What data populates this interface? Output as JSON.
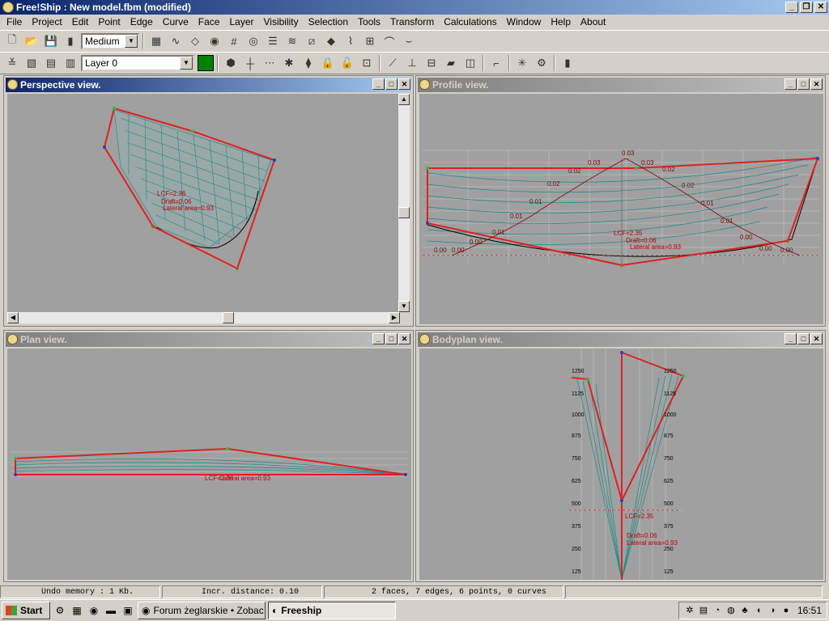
{
  "window": {
    "title": "Free!Ship  : New model.fbm (modified)"
  },
  "menu": [
    "File",
    "Project",
    "Edit",
    "Point",
    "Edge",
    "Curve",
    "Face",
    "Layer",
    "Visibility",
    "Selection",
    "Tools",
    "Transform",
    "Calculations",
    "Window",
    "Help",
    "About"
  ],
  "toolbar": {
    "precision": "Medium",
    "layer": "Layer 0",
    "layer_color": "#008000"
  },
  "views": {
    "perspective": {
      "title": "Perspective view."
    },
    "profile": {
      "title": "Profile view."
    },
    "plan": {
      "title": "Plan view."
    },
    "bodyplan": {
      "title": "Bodyplan view."
    }
  },
  "annotations": {
    "lcf": "LCF=2.36",
    "lcf_b": "LCF=2.35",
    "lateral": "Lateral area=0.93",
    "draft": "Draft=0.06",
    "lcf_plan": "LCF=2.36"
  },
  "profile_curve_labels": [
    "0.00",
    "0.00",
    "0.00",
    "0.01",
    "0.01",
    "0.01",
    "0.02",
    "0.02",
    "0.03",
    "0.03",
    "0.03",
    "0.02",
    "0.02",
    "0.01",
    "0.01",
    "0.00",
    "0.00",
    "0.00"
  ],
  "bodyplan_scale_left": [
    "1250",
    "1125",
    "1000",
    "875",
    "750",
    "625",
    "500",
    "375",
    "250",
    "125"
  ],
  "bodyplan_scale_right": [
    "1250",
    "1125",
    "1000",
    "875",
    "750",
    "625",
    "500",
    "375",
    "250",
    "125"
  ],
  "status": {
    "undo": "Undo memory : 1 Kb.",
    "incr": "Incr. distance: 0.10",
    "summary": "2 faces, 7 edges, 6 points, 0 curves"
  },
  "taskbar": {
    "start": "Start",
    "task1": "Forum żeglarskie • Zobac...",
    "task2": "Freeship",
    "clock": "16:51"
  }
}
